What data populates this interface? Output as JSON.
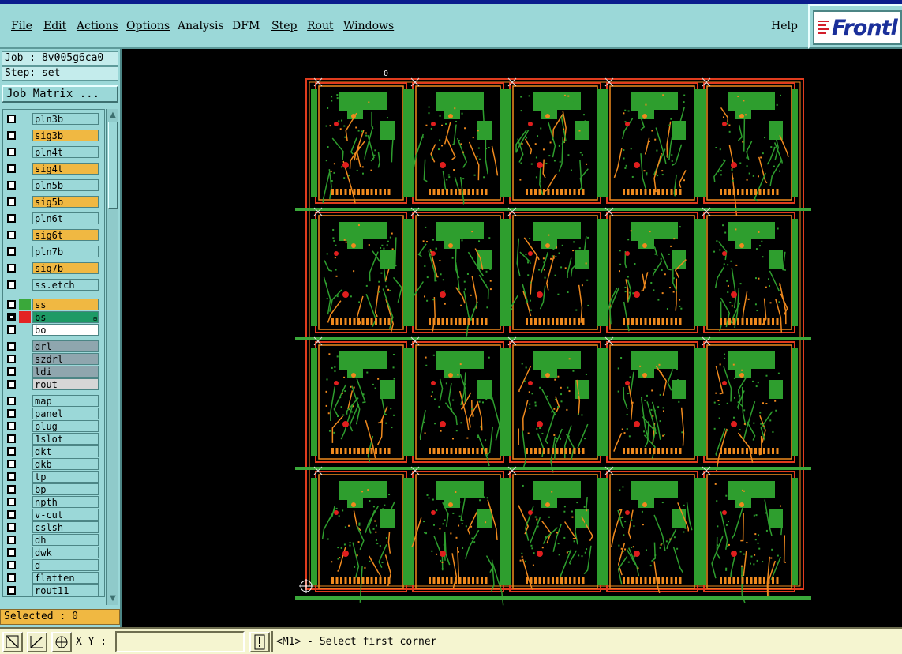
{
  "menubar": {
    "items": [
      "File",
      "Edit",
      "Actions",
      "Options",
      "Analysis",
      "DFM",
      "Step",
      "Rout",
      "Windows"
    ],
    "underline_first": [
      true,
      true,
      true,
      true,
      false,
      false,
      true,
      true,
      true
    ],
    "help": "Help",
    "logo_text": "Frontl"
  },
  "job": {
    "job_line": "Job : 8v005g6ca0",
    "step_line": "Step: set",
    "matrix_button": "Job Matrix ..."
  },
  "layers": [
    {
      "name": "pln3b",
      "color": "#9bd8d8",
      "swatch": "#9bd8d8",
      "checked": false
    },
    {
      "name": "sig3b",
      "color": "#f0b842",
      "swatch": "#9bd8d8",
      "checked": false
    },
    {
      "name": "pln4t",
      "color": "#9bd8d8",
      "swatch": "#9bd8d8",
      "checked": false
    },
    {
      "name": "sig4t",
      "color": "#f0b842",
      "swatch": "#9bd8d8",
      "checked": false
    },
    {
      "name": "pln5b",
      "color": "#9bd8d8",
      "swatch": "#9bd8d8",
      "checked": false
    },
    {
      "name": "sig5b",
      "color": "#f0b842",
      "swatch": "#9bd8d8",
      "checked": false
    },
    {
      "name": "pln6t",
      "color": "#9bd8d8",
      "swatch": "#9bd8d8",
      "checked": false
    },
    {
      "name": "sig6t",
      "color": "#f0b842",
      "swatch": "#9bd8d8",
      "checked": false
    },
    {
      "name": "pln7b",
      "color": "#9bd8d8",
      "swatch": "#9bd8d8",
      "checked": false
    },
    {
      "name": "sig7b",
      "color": "#f0b842",
      "swatch": "#9bd8d8",
      "checked": false
    },
    {
      "name": "ss.etch",
      "color": "#9bd8d8",
      "swatch": "#9bd8d8",
      "checked": false
    },
    {
      "name": "ss",
      "color": "#f0b842",
      "swatch": "#3aa83a",
      "checked": false
    },
    {
      "name": "bs",
      "color": "#1e9a66",
      "swatch": "#e32424",
      "checked": true,
      "marked": true
    },
    {
      "name": "bo",
      "color": "#ffffff",
      "swatch": "#9bd8d8",
      "checked": false
    },
    {
      "name": "drl",
      "color": "#8fa6ae",
      "swatch": "#9bd8d8",
      "checked": false
    },
    {
      "name": "szdrl",
      "color": "#8fa6ae",
      "swatch": "#9bd8d8",
      "checked": false
    },
    {
      "name": "ldi",
      "color": "#8fa6ae",
      "swatch": "#9bd8d8",
      "checked": false
    },
    {
      "name": "rout",
      "color": "#d6d6d6",
      "swatch": "#9bd8d8",
      "checked": false
    },
    {
      "name": "map",
      "color": "#9bd8d8",
      "swatch": "#9bd8d8",
      "checked": false
    },
    {
      "name": "panel",
      "color": "#9bd8d8",
      "swatch": "#9bd8d8",
      "checked": false
    },
    {
      "name": "plug",
      "color": "#9bd8d8",
      "swatch": "#9bd8d8",
      "checked": false
    },
    {
      "name": "1slot",
      "color": "#9bd8d8",
      "swatch": "#9bd8d8",
      "checked": false
    },
    {
      "name": "dkt",
      "color": "#9bd8d8",
      "swatch": "#9bd8d8",
      "checked": false
    },
    {
      "name": "dkb",
      "color": "#9bd8d8",
      "swatch": "#9bd8d8",
      "checked": false
    },
    {
      "name": "tp",
      "color": "#9bd8d8",
      "swatch": "#9bd8d8",
      "checked": false
    },
    {
      "name": "bp",
      "color": "#9bd8d8",
      "swatch": "#9bd8d8",
      "checked": false
    },
    {
      "name": "npth",
      "color": "#9bd8d8",
      "swatch": "#9bd8d8",
      "checked": false
    },
    {
      "name": "v-cut",
      "color": "#9bd8d8",
      "swatch": "#9bd8d8",
      "checked": false
    },
    {
      "name": "cslsh",
      "color": "#9bd8d8",
      "swatch": "#9bd8d8",
      "checked": false
    },
    {
      "name": "dh",
      "color": "#9bd8d8",
      "swatch": "#9bd8d8",
      "checked": false
    },
    {
      "name": "dwk",
      "color": "#9bd8d8",
      "swatch": "#9bd8d8",
      "checked": false
    },
    {
      "name": "d",
      "color": "#9bd8d8",
      "swatch": "#9bd8d8",
      "checked": false
    },
    {
      "name": "flatten",
      "color": "#9bd8d8",
      "swatch": "#9bd8d8",
      "checked": false
    },
    {
      "name": "rout11",
      "color": "#9bd8d8",
      "swatch": "#9bd8d8",
      "checked": false
    }
  ],
  "selected": "Selected : 0",
  "status": {
    "xy_label": "X Y :",
    "xy_value": "",
    "message": "<M1> - Select first corner"
  },
  "canvas": {
    "origin_label": "0",
    "panel_rows": 4,
    "panel_cols": 5,
    "colors": {
      "background": "#000000",
      "board": "#2e9e2e",
      "outline": "#e03c1e",
      "trace": "#f08a1e",
      "pad": "#e01e1e",
      "rail": "#3aa83a"
    }
  }
}
